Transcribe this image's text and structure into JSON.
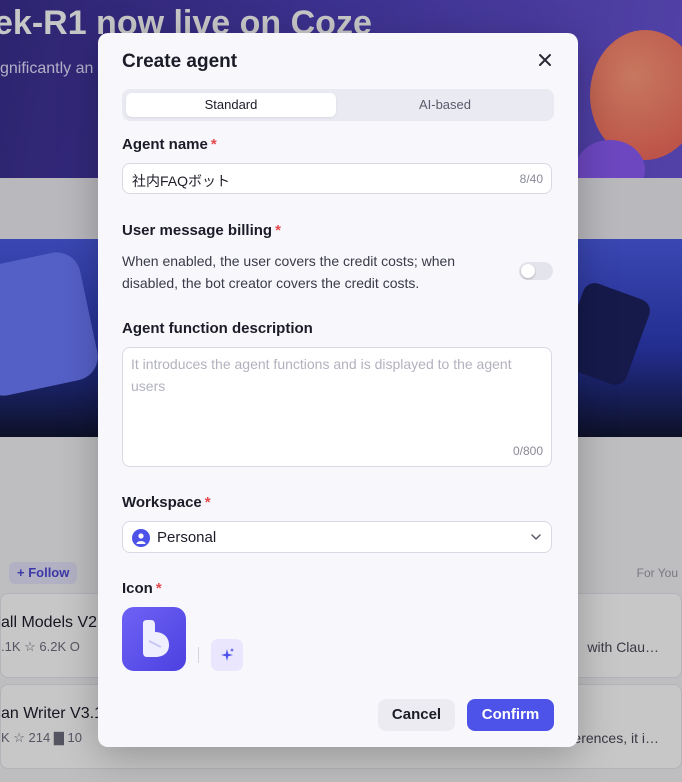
{
  "background": {
    "banner_title": "ek-R1 now live on Coze",
    "banner_subtitle": "gnificantly an",
    "follow_label": "+ Follow",
    "for_you_label": "For You",
    "cards": [
      {
        "title": "all Models V2.2",
        "meta": ".1K  ☆ 6.2K   O",
        "right_text": "with Clau…"
      },
      {
        "title": "an Writer V3.1",
        "meta": "K  ☆ 214   ▇ 10",
        "right_text": "erences, it i…"
      }
    ]
  },
  "modal": {
    "title": "Create agent",
    "tabs": [
      {
        "label": "Standard",
        "active": true
      },
      {
        "label": "AI-based",
        "active": false
      }
    ],
    "agent_name": {
      "label": "Agent name",
      "required_mark": "*",
      "value": "社内FAQボット",
      "counter": "8/40"
    },
    "billing": {
      "label": "User message billing",
      "required_mark": "*",
      "description": "When enabled, the user covers the credit costs; when disabled, the bot creator covers the credit costs.",
      "enabled": false
    },
    "description": {
      "label": "Agent function description",
      "placeholder": "It introduces the agent functions and is displayed to the agent users",
      "counter": "0/800"
    },
    "workspace": {
      "label": "Workspace",
      "required_mark": "*",
      "value": "Personal"
    },
    "icon": {
      "label": "Icon",
      "required_mark": "*"
    },
    "buttons": {
      "cancel": "Cancel",
      "confirm": "Confirm"
    },
    "colors": {
      "primary": "#4d53e8",
      "required": "#e5484d"
    }
  }
}
